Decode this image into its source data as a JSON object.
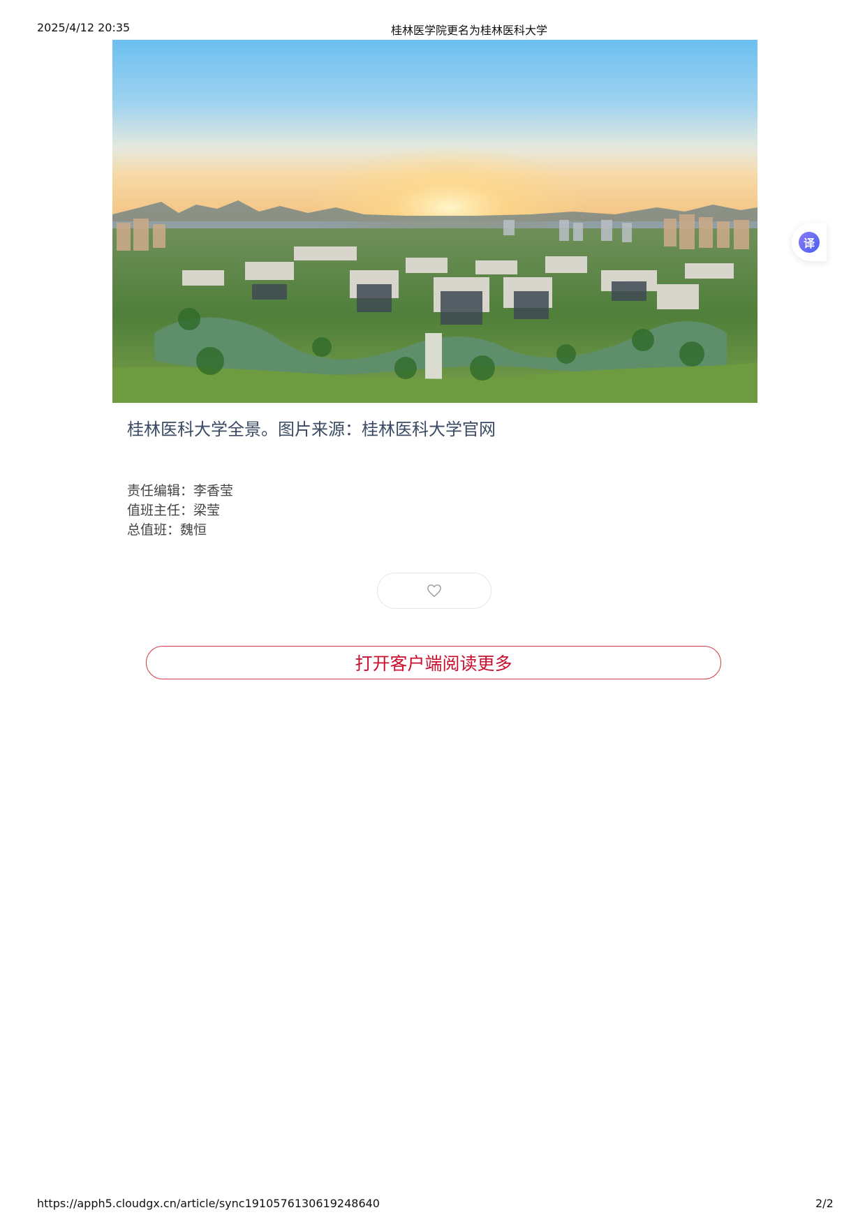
{
  "print_header": {
    "timestamp": "2025/4/12 20:35",
    "title": "桂林医学院更名为桂林医科大学"
  },
  "article": {
    "caption": "桂林医科大学全景。图片来源：桂林医科大学官网",
    "credits": [
      "责任编辑：李香莹",
      "值班主任：梁莹",
      "总值班：魏恒"
    ],
    "like_icon": "heart-icon",
    "open_app_label": "打开客户端阅读更多"
  },
  "translate_widget": {
    "label": "译"
  },
  "print_footer": {
    "url": "https://apph5.cloudgx.cn/article/sync1910576130619248640",
    "page": "2/2"
  },
  "colors": {
    "caption": "#3b4a63",
    "accent_red": "#c8102e",
    "translate_purple": "#5a5ff0"
  }
}
